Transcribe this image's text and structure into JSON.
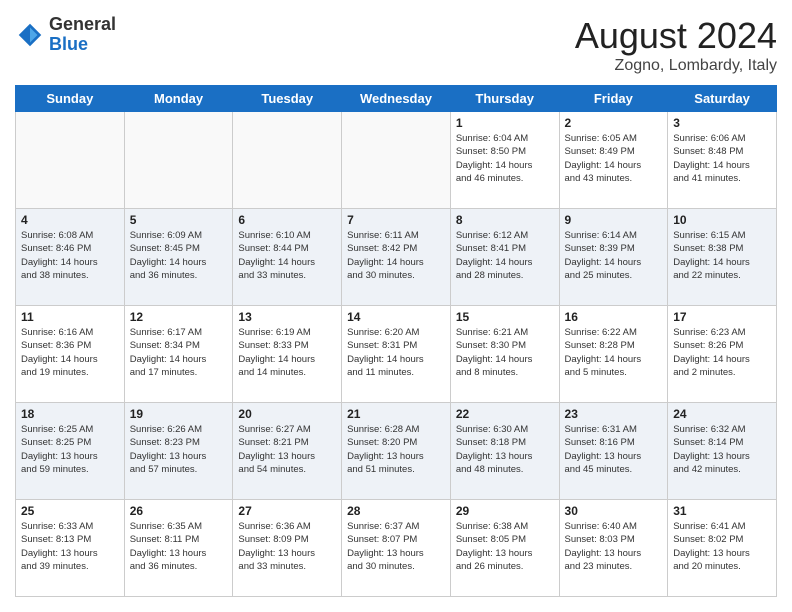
{
  "header": {
    "logo": {
      "general": "General",
      "blue": "Blue"
    },
    "month": "August 2024",
    "location": "Zogno, Lombardy, Italy"
  },
  "weekdays": [
    "Sunday",
    "Monday",
    "Tuesday",
    "Wednesday",
    "Thursday",
    "Friday",
    "Saturday"
  ],
  "weeks": [
    [
      {
        "day": "",
        "info": ""
      },
      {
        "day": "",
        "info": ""
      },
      {
        "day": "",
        "info": ""
      },
      {
        "day": "",
        "info": ""
      },
      {
        "day": "1",
        "info": "Sunrise: 6:04 AM\nSunset: 8:50 PM\nDaylight: 14 hours\nand 46 minutes."
      },
      {
        "day": "2",
        "info": "Sunrise: 6:05 AM\nSunset: 8:49 PM\nDaylight: 14 hours\nand 43 minutes."
      },
      {
        "day": "3",
        "info": "Sunrise: 6:06 AM\nSunset: 8:48 PM\nDaylight: 14 hours\nand 41 minutes."
      }
    ],
    [
      {
        "day": "4",
        "info": "Sunrise: 6:08 AM\nSunset: 8:46 PM\nDaylight: 14 hours\nand 38 minutes."
      },
      {
        "day": "5",
        "info": "Sunrise: 6:09 AM\nSunset: 8:45 PM\nDaylight: 14 hours\nand 36 minutes."
      },
      {
        "day": "6",
        "info": "Sunrise: 6:10 AM\nSunset: 8:44 PM\nDaylight: 14 hours\nand 33 minutes."
      },
      {
        "day": "7",
        "info": "Sunrise: 6:11 AM\nSunset: 8:42 PM\nDaylight: 14 hours\nand 30 minutes."
      },
      {
        "day": "8",
        "info": "Sunrise: 6:12 AM\nSunset: 8:41 PM\nDaylight: 14 hours\nand 28 minutes."
      },
      {
        "day": "9",
        "info": "Sunrise: 6:14 AM\nSunset: 8:39 PM\nDaylight: 14 hours\nand 25 minutes."
      },
      {
        "day": "10",
        "info": "Sunrise: 6:15 AM\nSunset: 8:38 PM\nDaylight: 14 hours\nand 22 minutes."
      }
    ],
    [
      {
        "day": "11",
        "info": "Sunrise: 6:16 AM\nSunset: 8:36 PM\nDaylight: 14 hours\nand 19 minutes."
      },
      {
        "day": "12",
        "info": "Sunrise: 6:17 AM\nSunset: 8:34 PM\nDaylight: 14 hours\nand 17 minutes."
      },
      {
        "day": "13",
        "info": "Sunrise: 6:19 AM\nSunset: 8:33 PM\nDaylight: 14 hours\nand 14 minutes."
      },
      {
        "day": "14",
        "info": "Sunrise: 6:20 AM\nSunset: 8:31 PM\nDaylight: 14 hours\nand 11 minutes."
      },
      {
        "day": "15",
        "info": "Sunrise: 6:21 AM\nSunset: 8:30 PM\nDaylight: 14 hours\nand 8 minutes."
      },
      {
        "day": "16",
        "info": "Sunrise: 6:22 AM\nSunset: 8:28 PM\nDaylight: 14 hours\nand 5 minutes."
      },
      {
        "day": "17",
        "info": "Sunrise: 6:23 AM\nSunset: 8:26 PM\nDaylight: 14 hours\nand 2 minutes."
      }
    ],
    [
      {
        "day": "18",
        "info": "Sunrise: 6:25 AM\nSunset: 8:25 PM\nDaylight: 13 hours\nand 59 minutes."
      },
      {
        "day": "19",
        "info": "Sunrise: 6:26 AM\nSunset: 8:23 PM\nDaylight: 13 hours\nand 57 minutes."
      },
      {
        "day": "20",
        "info": "Sunrise: 6:27 AM\nSunset: 8:21 PM\nDaylight: 13 hours\nand 54 minutes."
      },
      {
        "day": "21",
        "info": "Sunrise: 6:28 AM\nSunset: 8:20 PM\nDaylight: 13 hours\nand 51 minutes."
      },
      {
        "day": "22",
        "info": "Sunrise: 6:30 AM\nSunset: 8:18 PM\nDaylight: 13 hours\nand 48 minutes."
      },
      {
        "day": "23",
        "info": "Sunrise: 6:31 AM\nSunset: 8:16 PM\nDaylight: 13 hours\nand 45 minutes."
      },
      {
        "day": "24",
        "info": "Sunrise: 6:32 AM\nSunset: 8:14 PM\nDaylight: 13 hours\nand 42 minutes."
      }
    ],
    [
      {
        "day": "25",
        "info": "Sunrise: 6:33 AM\nSunset: 8:13 PM\nDaylight: 13 hours\nand 39 minutes."
      },
      {
        "day": "26",
        "info": "Sunrise: 6:35 AM\nSunset: 8:11 PM\nDaylight: 13 hours\nand 36 minutes."
      },
      {
        "day": "27",
        "info": "Sunrise: 6:36 AM\nSunset: 8:09 PM\nDaylight: 13 hours\nand 33 minutes."
      },
      {
        "day": "28",
        "info": "Sunrise: 6:37 AM\nSunset: 8:07 PM\nDaylight: 13 hours\nand 30 minutes."
      },
      {
        "day": "29",
        "info": "Sunrise: 6:38 AM\nSunset: 8:05 PM\nDaylight: 13 hours\nand 26 minutes."
      },
      {
        "day": "30",
        "info": "Sunrise: 6:40 AM\nSunset: 8:03 PM\nDaylight: 13 hours\nand 23 minutes."
      },
      {
        "day": "31",
        "info": "Sunrise: 6:41 AM\nSunset: 8:02 PM\nDaylight: 13 hours\nand 20 minutes."
      }
    ]
  ]
}
